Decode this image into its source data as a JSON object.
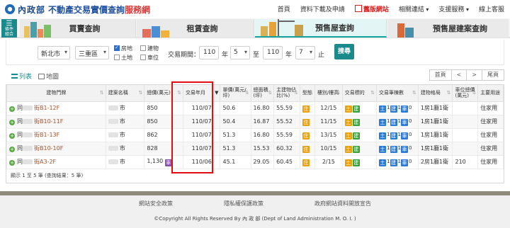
{
  "header": {
    "ministry": "內政部",
    "site_name": "不動產交易實價查詢",
    "site_suffix": "服務網",
    "nav": [
      "首頁",
      "資料下載及申請",
      "舊版網站",
      "相關連結",
      "支援服務",
      "線上客服"
    ]
  },
  "menu_btn": "條件\n組合",
  "tabs": [
    "買賣查詢",
    "租賃查詢",
    "預售屋查詢",
    "預售屋建案查詢"
  ],
  "filter": {
    "city": "新北市",
    "district": "三重區",
    "checkboxes": [
      {
        "label": "房地",
        "checked": true
      },
      {
        "label": "建物",
        "checked": false
      },
      {
        "label": "土地",
        "checked": false
      },
      {
        "label": "車位",
        "checked": false
      }
    ],
    "period_label": "交易期間：",
    "from_year": "110",
    "year_unit": "年",
    "from_month": "5",
    "to": "至",
    "to_year": "110",
    "to_month": "7",
    "end": "止",
    "search": "搜尋"
  },
  "view": {
    "list": "列表",
    "map": "地圖"
  },
  "pager": [
    "首頁",
    "<",
    ">",
    "尾頁"
  ],
  "columns": [
    "建物門牌",
    "建案名稱",
    "總價(萬元)",
    "交易年月",
    "單價(萬元/坪)",
    "總面積(坪)",
    "主建物佔比(%)",
    "型態",
    "樓別/樓高",
    "交易標的",
    "交易筆棟數",
    "建物格局",
    "車位總價(萬元)",
    "主要用途"
  ],
  "rows": [
    {
      "addr": "街B1-12F",
      "project": "市",
      "price": "850",
      "price_badge": "",
      "date": "110/07",
      "unit": "50.6",
      "area": "16.80",
      "ratio": "55.59",
      "floor": "12/15",
      "layout": "1房1廳1衛",
      "parking": "",
      "use": "住家用"
    },
    {
      "addr": "街B10-11F",
      "project": "市",
      "price": "850",
      "price_badge": "",
      "date": "110/07",
      "unit": "50.4",
      "area": "16.87",
      "ratio": "55.52",
      "floor": "11/15",
      "layout": "1房1廳1衛",
      "parking": "",
      "use": "住家用"
    },
    {
      "addr": "街B1-13F",
      "project": "市",
      "price": "862",
      "price_badge": "",
      "date": "110/07",
      "unit": "51.3",
      "area": "16.80",
      "ratio": "55.59",
      "floor": "13/15",
      "layout": "1房1廳1衛",
      "parking": "",
      "use": "住家用"
    },
    {
      "addr": "街B10-10F",
      "project": "市",
      "price": "828",
      "price_badge": "",
      "date": "110/07",
      "unit": "51.3",
      "area": "15.53",
      "ratio": "60.32",
      "floor": "10/15",
      "layout": "1房1廳1衛",
      "parking": "",
      "use": "住家用"
    },
    {
      "addr": "街A3-2F",
      "project": "市",
      "price": "1,130",
      "price_badge": "車",
      "date": "110/06",
      "unit": "45.1",
      "area": "29.05",
      "ratio": "60.45",
      "floor": "2/15",
      "layout": "2房1廳1衛",
      "parking": "210",
      "use": "住家用"
    }
  ],
  "type_badge": "住",
  "target_badges": [
    "土",
    "建"
  ],
  "count_badges": [
    {
      "k": "土",
      "v": "1"
    },
    {
      "k": "建",
      "v": "1"
    },
    {
      "k": "車",
      "v": "0"
    }
  ],
  "row_prefix": "同",
  "result_text": "顯示 1 至 5 筆 (查詢結果：5 筆)",
  "footer": {
    "links": [
      "網站安全政策",
      "隱私權保護政策",
      "政府網站資料開放宣告"
    ],
    "copyright": "©Copyright All Rights Reserved By 內 政 部 (Dept of Land Administration M. O. I. )"
  },
  "colors": {
    "accent": "#1b8a8d",
    "highlight": "#e01010"
  }
}
